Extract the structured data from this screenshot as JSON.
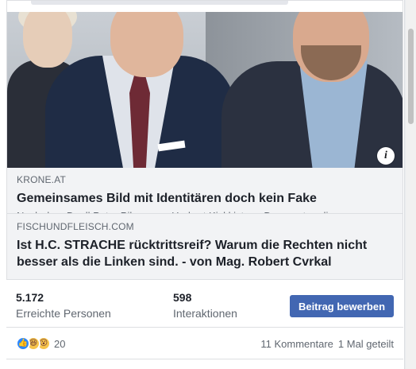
{
  "inner_link": {
    "domain": "KRONE.AT",
    "title": "Gemeinsames Bild mit Identitären doch kein Fake",
    "description": "Nach dem Duell Peter Pilz gegen Herbert Kickl ist am Donnerstag die"
  },
  "outer_link": {
    "domain": "FISCHUNDFLEISCH.COM",
    "title": "Ist H.C. STRACHE rücktrittsreif? Warum die Rechten nicht besser als die Linken sind. - von Mag. Robert Cvrkal"
  },
  "info_icon_glyph": "i",
  "stats": {
    "reach_value": "5.172",
    "reach_label": "Erreichte Personen",
    "engagement_value": "598",
    "engagement_label": "Interaktionen"
  },
  "boost_button": {
    "label": "Beitrag bewerben",
    "color": "#4267b2"
  },
  "reactions": {
    "icons": [
      "like-icon",
      "haha-icon",
      "wow-icon"
    ],
    "like_glyph": "👍",
    "haha_glyph": "😆",
    "wow_glyph": "😮",
    "count": "20"
  },
  "footer_meta": {
    "comments": "11 Kommentare",
    "shares": "1 Mal geteilt"
  }
}
